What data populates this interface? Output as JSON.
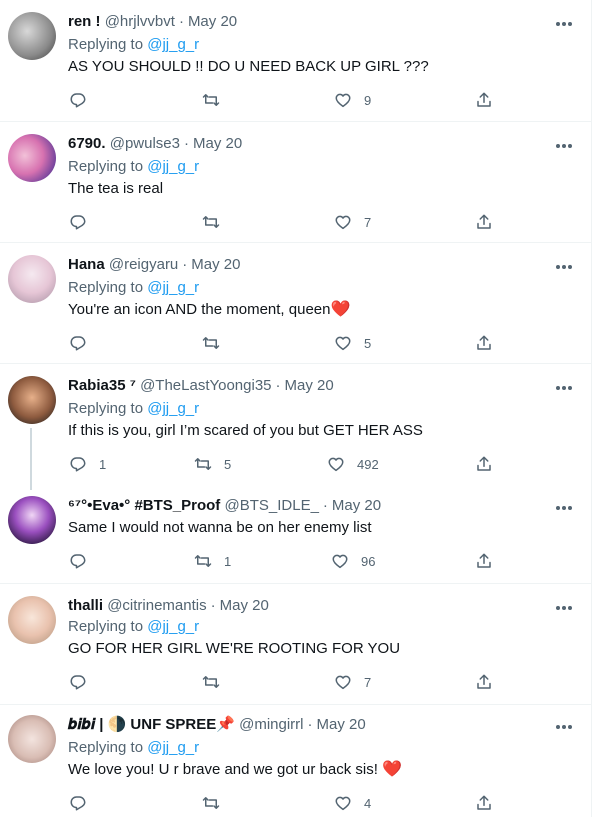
{
  "theme": {
    "text": "#0f1419",
    "secondary": "#536471",
    "link": "#1d9bf0",
    "divider": "#eff3f4",
    "heart": "#e0245e"
  },
  "icons": [
    "reply-icon",
    "retweet-icon",
    "like-icon",
    "share-icon",
    "more-icon"
  ],
  "replies": [
    {
      "name": "ren !",
      "handle": "@hrjlvvbvt",
      "dot": "·",
      "time": "May 20",
      "replying_label": "Replying to",
      "replying_to": "@jj_g_r",
      "text": "AS YOU SHOULD !! DO U NEED BACK UP GIRL ???",
      "reply_count": "",
      "retweet_count": "",
      "like_count": "9"
    },
    {
      "name": "6790.",
      "handle": "@pwulse3",
      "dot": "·",
      "time": "May 20",
      "replying_label": "Replying to",
      "replying_to": "@jj_g_r",
      "text": "The tea is real",
      "reply_count": "",
      "retweet_count": "",
      "like_count": "7"
    },
    {
      "name": "Hana",
      "handle": "@reigyaru",
      "dot": "·",
      "time": "May 20",
      "replying_label": "Replying to",
      "replying_to": "@jj_g_r",
      "text": "You're an icon AND the moment, queen",
      "emoji": "❤️",
      "reply_count": "",
      "retweet_count": "",
      "like_count": "5"
    },
    {
      "name": "Rabia35 ⁷",
      "handle": "@TheLastYoongi35",
      "dot": "·",
      "time": "May 20",
      "replying_label": "Replying to",
      "replying_to": "@jj_g_r",
      "text": "If this is you, girl I’m scared of you but GET HER ASS",
      "reply_count": "1",
      "retweet_count": "5",
      "like_count": "492"
    },
    {
      "name": "⁶⁷°•Eva•° #BTS_Proof",
      "handle": "@BTS_IDLE_",
      "dot": "·",
      "time": "May 20",
      "text": "Same I would not wanna be on her enemy list",
      "reply_count": "",
      "retweet_count": "1",
      "like_count": "96"
    },
    {
      "name": "thalli",
      "handle": "@citrinemantis",
      "dot": "·",
      "time": "May 20",
      "replying_label": "Replying to",
      "replying_to": "@jj_g_r",
      "text": "GO FOR HER GIRL WE'RE ROOTING FOR YOU",
      "reply_count": "",
      "retweet_count": "",
      "like_count": "7"
    },
    {
      "name": "𝒃𝒊𝒃𝒊 | 🌗 UNF SPREE📌",
      "handle": "@mingirrl",
      "dot": "·",
      "time": "May 20",
      "replying_label": "Replying to",
      "replying_to": "@jj_g_r",
      "text": "We love you! U r brave and we got ur back sis!",
      "emoji": "❤️",
      "reply_count": "",
      "retweet_count": "",
      "like_count": "4"
    }
  ]
}
